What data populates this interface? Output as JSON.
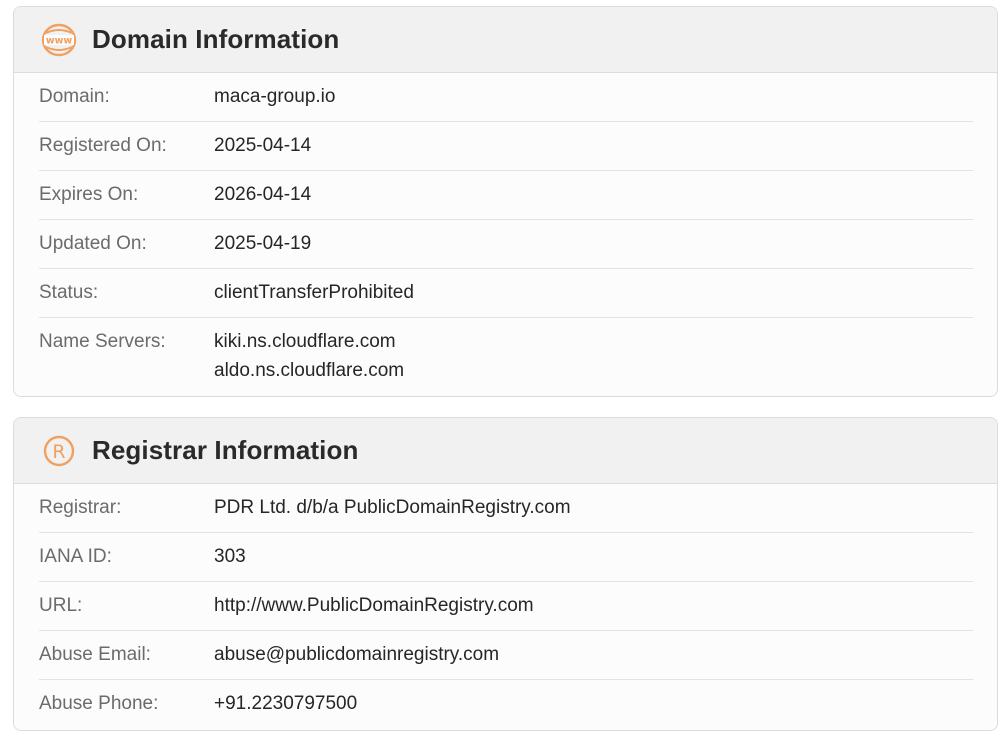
{
  "domain_card": {
    "title": "Domain Information",
    "icon": "www-globe-icon",
    "accent_color": "#f0a060",
    "rows": [
      {
        "label": "Domain:",
        "value": "maca-group.io"
      },
      {
        "label": "Registered On:",
        "value": "2025-04-14"
      },
      {
        "label": "Expires On:",
        "value": "2026-04-14"
      },
      {
        "label": "Updated On:",
        "value": "2025-04-19"
      },
      {
        "label": "Status:",
        "value": "clientTransferProhibited"
      },
      {
        "label": "Name Servers:",
        "values": [
          "kiki.ns.cloudflare.com",
          "aldo.ns.cloudflare.com"
        ]
      }
    ]
  },
  "registrar_card": {
    "title": "Registrar Information",
    "icon": "registered-icon",
    "icon_glyph": "®",
    "accent_color": "#f0a060",
    "rows": [
      {
        "label": "Registrar:",
        "value": "PDR Ltd. d/b/a PublicDomainRegistry.com"
      },
      {
        "label": "IANA ID:",
        "value": "303"
      },
      {
        "label": "URL:",
        "value": "http://www.PublicDomainRegistry.com"
      },
      {
        "label": "Abuse Email:",
        "value": "abuse@publicdomainregistry.com"
      },
      {
        "label": "Abuse Phone:",
        "value": "+91.2230797500"
      }
    ]
  }
}
